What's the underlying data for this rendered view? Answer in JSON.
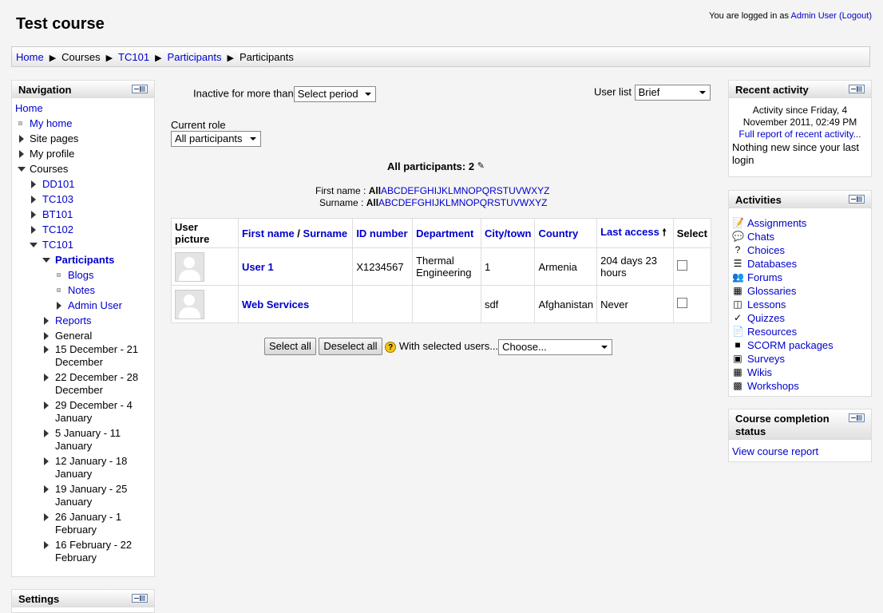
{
  "header": {
    "title": "Test course",
    "login_prefix": "You are logged in as",
    "user": "Admin User",
    "logout": "(Logout)"
  },
  "breadcrumb": [
    "Home",
    "Courses",
    "TC101",
    "Participants",
    "Participants"
  ],
  "navigation": {
    "title": "Navigation",
    "home": "Home",
    "my_home": "My home",
    "site_pages": "Site pages",
    "my_profile": "My profile",
    "courses": "Courses",
    "course_list": [
      "DD101",
      "TC103",
      "BT101",
      "TC102",
      "TC101"
    ],
    "participants": "Participants",
    "blogs": "Blogs",
    "notes": "Notes",
    "admin_user": "Admin User",
    "reports": "Reports",
    "general": "General",
    "weeks": [
      [
        "15 December - 21",
        "December"
      ],
      [
        "22 December - 28",
        "December"
      ],
      [
        "29 December - 4",
        "January"
      ],
      [
        "5 January - 11",
        "January"
      ],
      [
        "12 January - 18",
        "January"
      ],
      [
        "19 January - 25",
        "January"
      ],
      [
        "26 January - 1",
        "February"
      ],
      [
        "16 February - 22",
        "February"
      ]
    ]
  },
  "settings_partial": "Settings",
  "filters": {
    "inactive_label": "Inactive for more than",
    "inactive_value": "Select period",
    "userlist_label": "User list",
    "userlist_value": "Brief",
    "role_label": "Current role",
    "role_value": "All participants"
  },
  "participants": {
    "heading": "All participants: 2",
    "firstname_label": "First name :",
    "surname_label": "Surname :",
    "all": "All",
    "letters": "ABCDEFGHIJKLMNOPQRSTUVWXYZ",
    "columns": {
      "picture": "User picture",
      "first_name": "First name",
      "slash": " / ",
      "surname": "Surname",
      "id_number": "ID number",
      "department": "Department",
      "city": "City/town",
      "country": "Country",
      "last_access": "Last access",
      "select": "Select"
    },
    "rows": [
      {
        "name": "User 1",
        "id": "X1234567",
        "dept": "Thermal Engineering",
        "city": "1",
        "country": "Armenia",
        "last": "204 days 23 hours"
      },
      {
        "name": "Web Services",
        "id": "",
        "dept": "",
        "city": "sdf",
        "country": "Afghanistan",
        "last": "Never"
      }
    ],
    "select_all": "Select all",
    "deselect_all": "Deselect all",
    "with_selected": "With selected users...",
    "choose": "Choose..."
  },
  "recent_activity": {
    "title": "Recent activity",
    "since": "Activity since Friday, 4 November 2011, 02:49 PM",
    "full_report": "Full report of recent activity...",
    "nothing": "Nothing new since your last login"
  },
  "activities": {
    "title": "Activities",
    "items": [
      {
        "label": "Assignments",
        "icon": "assignment-icon"
      },
      {
        "label": "Chats",
        "icon": "chat-icon"
      },
      {
        "label": "Choices",
        "icon": "choice-icon"
      },
      {
        "label": "Databases",
        "icon": "database-icon"
      },
      {
        "label": "Forums",
        "icon": "forum-icon"
      },
      {
        "label": "Glossaries",
        "icon": "glossary-icon"
      },
      {
        "label": "Lessons",
        "icon": "lesson-icon"
      },
      {
        "label": "Quizzes",
        "icon": "quiz-icon"
      },
      {
        "label": "Resources",
        "icon": "resource-icon"
      },
      {
        "label": "SCORM packages",
        "icon": "scorm-icon"
      },
      {
        "label": "Surveys",
        "icon": "survey-icon"
      },
      {
        "label": "Wikis",
        "icon": "wiki-icon"
      },
      {
        "label": "Workshops",
        "icon": "workshop-icon"
      }
    ]
  },
  "completion": {
    "title": "Course completion status",
    "link": "View course report"
  }
}
